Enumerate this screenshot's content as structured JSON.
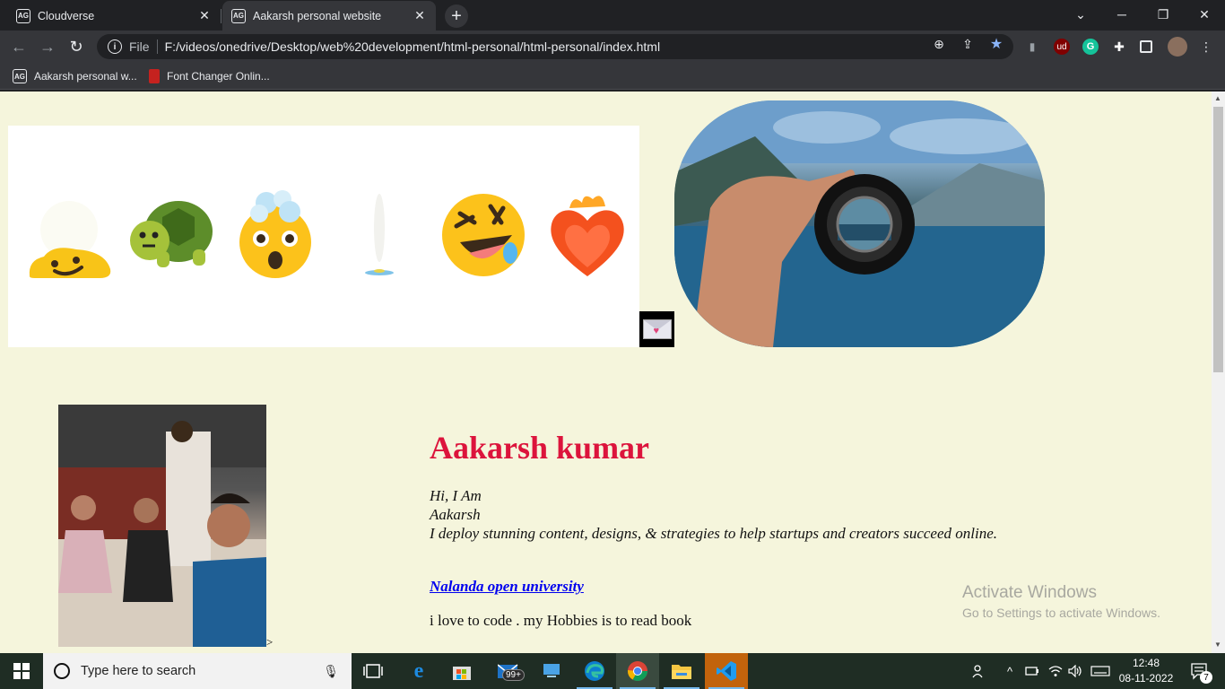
{
  "browser": {
    "tabs": [
      {
        "title": "Cloudverse",
        "favicon": "AG",
        "active": false
      },
      {
        "title": "Aakarsh personal website",
        "favicon": "AG",
        "active": true
      }
    ],
    "new_tab_icon": "plus-icon",
    "address": {
      "scheme_label": "File",
      "url": "F:/videos/onedrive/Desktop/web%20development/html-personal/html-personal/index.html"
    },
    "bookmarks": [
      {
        "label": "Aakarsh personal w...",
        "favicon": "AG"
      },
      {
        "label": "Font Changer Onlin...",
        "favicon": "font-changer-icon"
      }
    ],
    "extensions": [
      {
        "name": "ublock-icon",
        "label": "ud",
        "color": "#800000"
      },
      {
        "name": "grammarly-icon",
        "label": "G",
        "color": "#15c39a"
      }
    ]
  },
  "page": {
    "emojis": [
      "melting-face",
      "turtle",
      "exploding-head",
      "dissolving-figure",
      "rolling-laughing",
      "heart-on-fire"
    ],
    "name": "Aakarsh kumar",
    "intro_lines": [
      "Hi, I Am",
      "Aakarsh",
      "I deploy stunning content, designs, & strategies to help startups and creators succeed online."
    ],
    "university_link": "Nalanda open university",
    "hobby": "i love to code . my Hobbies is to read book",
    "broken_tag_text": ">",
    "colors": {
      "background": "#f5f5dc",
      "name": "#dc143c",
      "link": "#0000ee"
    }
  },
  "watermark": {
    "line1": "Activate Windows",
    "line2": "Go to Settings to activate Windows."
  },
  "taskbar": {
    "search_placeholder": "Type here to search",
    "mail_badge": "99+",
    "time": "12:48",
    "date": "08-11-2022",
    "notification_count": "7"
  }
}
